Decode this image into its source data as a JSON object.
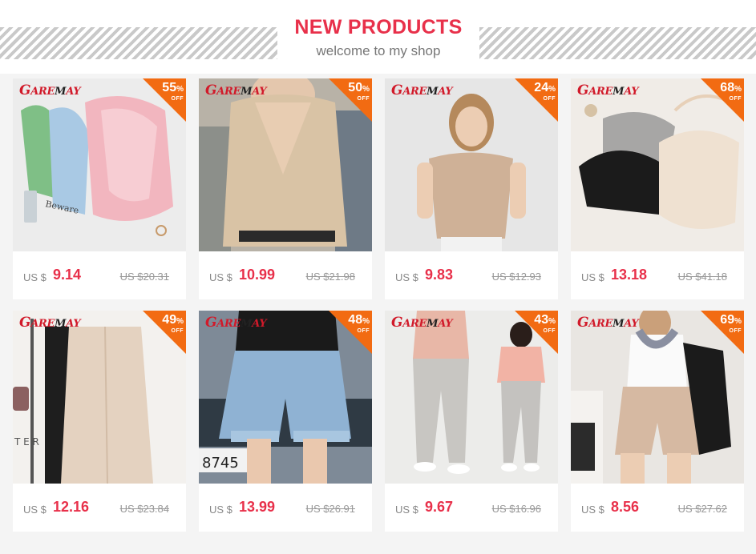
{
  "header": {
    "title": "NEW PRODUCTS",
    "subtitle": "welcome to my shop"
  },
  "colors": {
    "accent": "#e8304a",
    "badge": "#f26b12",
    "brand": "#d11a2a"
  },
  "brand_logo": "GAREMAY",
  "products": [
    {
      "discount": "55",
      "currency": "US $",
      "price": "9.14",
      "old_price": "US $20.31",
      "image": "pink-satin-camisoles"
    },
    {
      "discount": "50",
      "currency": "US $",
      "price": "10.99",
      "old_price": "US $21.98",
      "image": "champagne-satin-vneck-tank"
    },
    {
      "discount": "24",
      "currency": "US $",
      "price": "9.83",
      "old_price": "US $12.93",
      "image": "champagne-satin-tee-model"
    },
    {
      "discount": "68",
      "currency": "US $",
      "price": "13.18",
      "old_price": "US $41.18",
      "image": "knit-camisoles-flatlay"
    },
    {
      "discount": "49",
      "currency": "US $",
      "price": "12.16",
      "old_price": "US $23.84",
      "image": "beige-wide-leg-pants"
    },
    {
      "discount": "48",
      "currency": "US $",
      "price": "13.99",
      "old_price": "US $26.91",
      "image": "denim-shorts"
    },
    {
      "discount": "43",
      "currency": "US $",
      "price": "9.67",
      "old_price": "US $16.96",
      "image": "grey-harem-pants"
    },
    {
      "discount": "69",
      "currency": "US $",
      "price": "8.56",
      "old_price": "US $27.62",
      "image": "beige-bermuda-shorts"
    }
  ]
}
